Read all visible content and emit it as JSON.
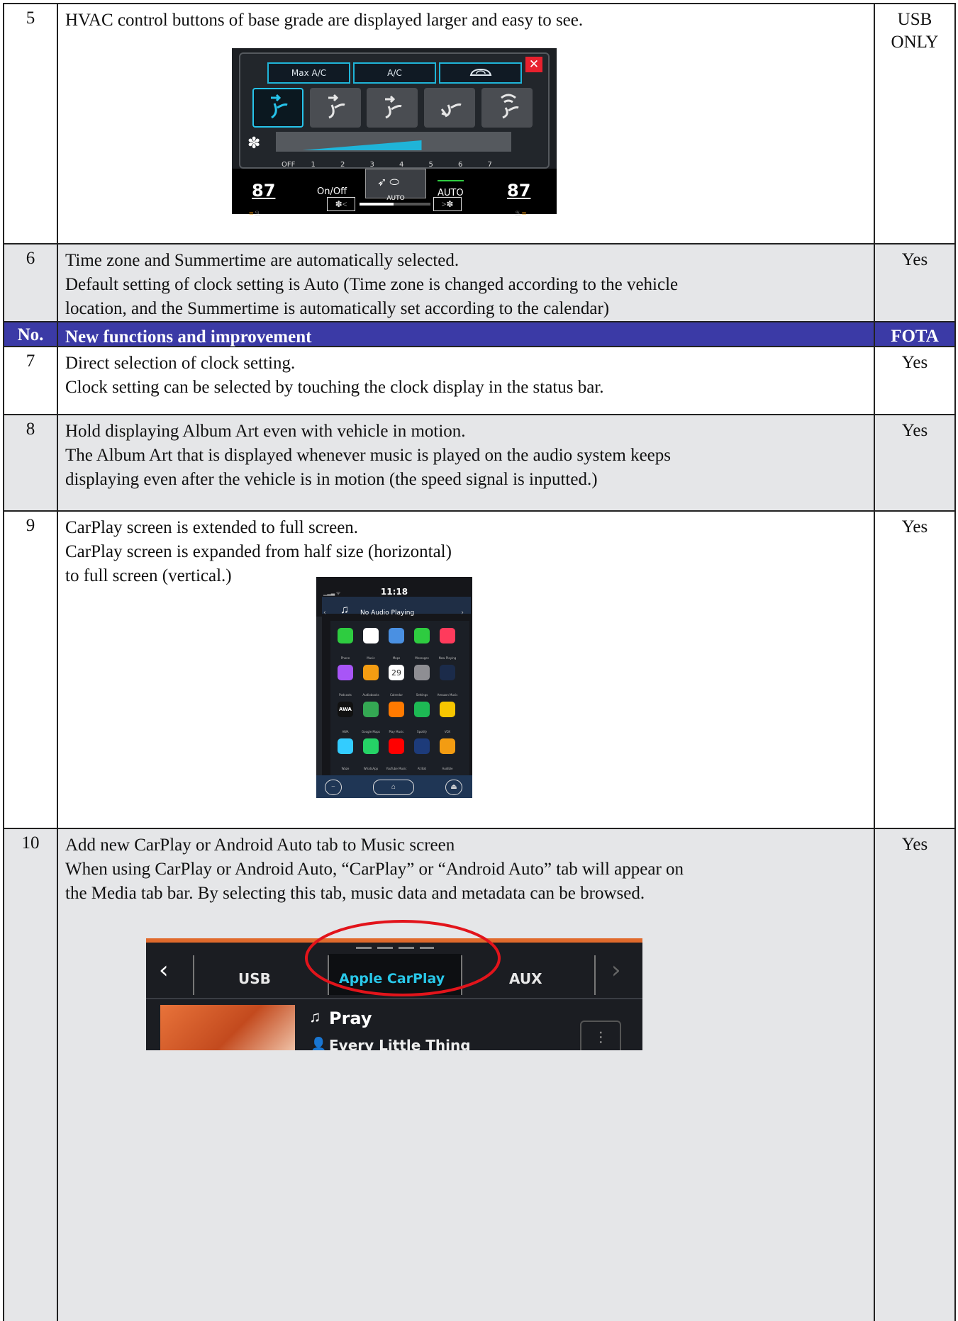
{
  "rows": [
    {
      "no": "5",
      "desc": [
        "HVAC control buttons of base grade are displayed larger and easy to see."
      ],
      "fota": [
        "USB",
        "ONLY"
      ],
      "image": {
        "type": "hvac",
        "buttons": [
          "Max A/C",
          "A/C"
        ],
        "fan_labels": [
          "OFF",
          "1",
          "2",
          "3",
          "4",
          "5",
          "6",
          "7"
        ],
        "fan_level": 4,
        "left_temp": "87",
        "right_temp": "87",
        "on_off": "On/Off",
        "auto_small": "AUTO",
        "auto": "AUTO",
        "close_icon": "close-icon",
        "accent": "#1fb4d8"
      }
    },
    {
      "no": "6",
      "desc": [
        "Time zone and Summertime are automatically selected.",
        "Default setting of clock setting is Auto (Time zone is changed according to the vehicle",
        "location, and the Summertime is automatically set according to the calendar)"
      ],
      "fota": [
        "Yes"
      ]
    },
    {
      "header": true,
      "no": "No.",
      "desc": [
        "New functions and improvement"
      ],
      "fota": [
        "FOTA"
      ]
    },
    {
      "no": "7",
      "desc": [
        "Direct selection of clock setting.",
        "Clock setting can be selected by touching the clock display in the status bar."
      ],
      "fota": [
        "Yes"
      ]
    },
    {
      "no": "8",
      "desc": [
        "Hold displaying Album Art even with vehicle in motion.",
        "The Album Art that is displayed whenever music is played on the audio system keeps",
        "displaying even after the vehicle is in motion (the speed signal is inputted.)"
      ],
      "fota": [
        "Yes"
      ]
    },
    {
      "no": "9",
      "desc": [
        "CarPlay screen is extended to full screen.",
        "CarPlay screen is expanded from half size (horizontal)",
        "to full screen (vertical.)"
      ],
      "fota": [
        "Yes"
      ],
      "image": {
        "type": "carplay",
        "time": "11:18",
        "now_playing": "No Audio Playing",
        "day": "29",
        "aw": "AWA",
        "apps": [
          [
            "Phone",
            "Music",
            "Maps",
            "Messages",
            "Now Playing"
          ],
          [
            "Podcasts",
            "Audiobooks",
            "Calendar",
            "Settings",
            "Amazon Music"
          ],
          [
            "AWA",
            "Google Maps",
            "Play Music",
            "Spotify",
            "VOX"
          ],
          [
            "Waze",
            "WhatsApp",
            "YouTube Music",
            "At Bat",
            "Audible"
          ]
        ],
        "app_colors": [
          [
            "#2ecc40",
            "#ffffff",
            "#4a90e2",
            "#2ecc40",
            "#ff3b5c"
          ],
          [
            "#a855f7",
            "#f39c12",
            "#ffffff",
            "#8e8e93",
            "#1b2b4a"
          ],
          [
            "#111111",
            "#34a853",
            "#ff7a00",
            "#1db954",
            "#f7c600"
          ],
          [
            "#33ccff",
            "#25d366",
            "#ff0000",
            "#1d3b7a",
            "#f39c12"
          ]
        ]
      }
    },
    {
      "no": "10",
      "desc": [
        "Add new CarPlay or Android Auto tab to Music screen",
        "When using CarPlay or Android Auto, “CarPlay” or “Android Auto” tab will appear on",
        "the Media tab bar. By selecting this tab, music data and metadata can be browsed."
      ],
      "fota": [
        "Yes"
      ],
      "image": {
        "type": "music-tabs",
        "tabs": [
          "USB",
          "Apple CarPlay",
          "AUX"
        ],
        "song": "Pray",
        "artist": "Every Little Thing",
        "highlight": "#e2141b",
        "accent": "#29c7e8"
      }
    }
  ]
}
